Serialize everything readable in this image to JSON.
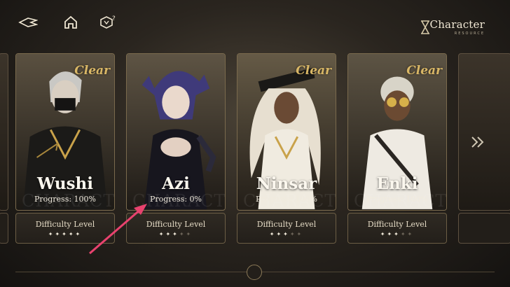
{
  "header": {
    "title": "Character",
    "subtitle": "RESOURCE",
    "icons": [
      "back-arrow-icon",
      "home-icon",
      "help-icon"
    ]
  },
  "cards": [
    {
      "name": "Wushi",
      "progress": "Progress: 100%",
      "clear": "Clear",
      "difficulty_label": "Difficulty Level",
      "stars_filled": 5,
      "stars_total": 5,
      "ghost_text": "CHARACTER"
    },
    {
      "name": "Azi",
      "progress": "Progress: 0%",
      "clear": "",
      "difficulty_label": "Difficulty Level",
      "stars_filled": 3,
      "stars_total": 5,
      "ghost_text": "CHARACTER"
    },
    {
      "name": "Ninsar",
      "progress": "Progress: 100%",
      "clear": "Clear",
      "difficulty_label": "Difficulty Level",
      "stars_filled": 3,
      "stars_total": 5,
      "ghost_text": "CHARACTER"
    },
    {
      "name": "Enki",
      "progress": "Progress: 100%",
      "clear": "Clear",
      "difficulty_label": "Difficulty Level",
      "stars_filled": 3,
      "stars_total": 5,
      "ghost_text": "CHARACTER"
    }
  ],
  "colors": {
    "accent_gold": "#d9b766",
    "annotation_arrow": "#e8426e"
  }
}
